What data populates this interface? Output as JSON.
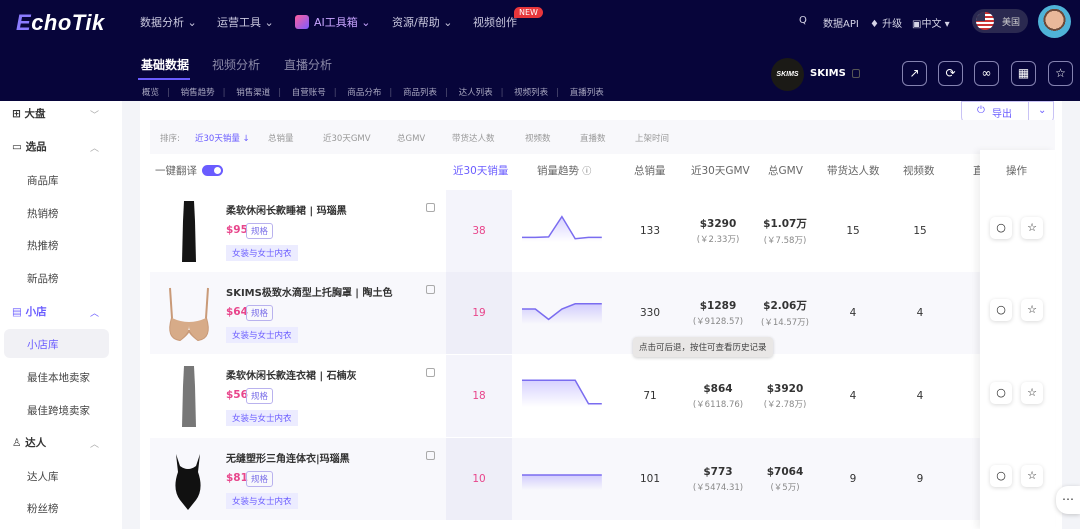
{
  "header": {
    "logo": "EchoTik",
    "nav": [
      "数据分析",
      "运营工具",
      "AI工具箱",
      "资源/帮助",
      "视频创作"
    ],
    "new_badge": "NEW",
    "search": "Q",
    "api": "数据API",
    "upgrade": "升级",
    "language": "中文",
    "country": "美国"
  },
  "tabs": [
    "基础数据",
    "视频分析",
    "直播分析"
  ],
  "subnav": [
    "概览",
    "销售趋势",
    "销售渠道",
    "自营账号",
    "商品分布",
    "商品列表",
    "达人列表",
    "视频列表",
    "直播列表"
  ],
  "shop": {
    "logo_text": "SKIMS",
    "name": "SKIMS"
  },
  "sidebar": {
    "groups": [
      {
        "label": "大盘"
      },
      {
        "label": "选品",
        "items": [
          "商品库",
          "热销榜",
          "热推榜",
          "新品榜"
        ]
      },
      {
        "label": "小店",
        "items": [
          "小店库",
          "最佳本地卖家",
          "最佳跨境卖家"
        ]
      },
      {
        "label": "达人",
        "items": [
          "达人库",
          "粉丝榜"
        ]
      }
    ]
  },
  "sort": {
    "label": "排序:",
    "options": [
      "近30天销量 ↓",
      "总销量",
      "近30天GMV",
      "总GMV",
      "带货达人数",
      "视频数",
      "直播数",
      "上架时间"
    ]
  },
  "export": "导出",
  "translate": "一键翻译",
  "columns": [
    "近30天销量",
    "销量趋势",
    "总销量",
    "近30天GMV",
    "总GMV",
    "带货达人数",
    "视频数",
    "直",
    "操作"
  ],
  "spec_label": "规格",
  "tooltip": "点击可后退，按住可查看历史记录",
  "colors": {
    "accent": "#6a5cff",
    "pink": "#e8458b",
    "header": "#07053a"
  },
  "rows": [
    {
      "title": "柔软休闲长款睡裙 | 玛瑙黑",
      "price": "$95",
      "category": "女装与女士内衣",
      "sales30": "38",
      "total": "133",
      "gmv30": "$3290",
      "gmv30_cny": "(￥2.33万)",
      "gmv": "$1.07万",
      "gmv_cny": "(￥7.58万)",
      "creators": "15",
      "videos": "15",
      "trend": [
        0.1,
        0.1,
        0.12,
        0.9,
        0.05,
        0.1,
        0.1
      ]
    },
    {
      "title": "SKIMS极致水滴型上托胸罩 | 陶土色",
      "price": "$64",
      "category": "女装与女士内衣",
      "sales30": "19",
      "total": "330",
      "gmv30": "$1289",
      "gmv30_cny": "(￥9128.57)",
      "gmv": "$2.06万",
      "gmv_cny": "(￥14.57万)",
      "creators": "4",
      "videos": "4",
      "trend": [
        0.5,
        0.5,
        0.1,
        0.5,
        0.7,
        0.7,
        0.7
      ]
    },
    {
      "title": "柔软休闲长款连衣裙 | 石楠灰",
      "price": "$56",
      "category": "女装与女士内衣",
      "sales30": "18",
      "total": "71",
      "gmv30": "$864",
      "gmv30_cny": "(￥6118.76)",
      "gmv": "$3920",
      "gmv_cny": "(￥2.78万)",
      "creators": "4",
      "videos": "4",
      "trend": [
        0.95,
        0.95,
        0.95,
        0.95,
        0.95,
        0.05,
        0.05
      ]
    },
    {
      "title": "无缝塑形三角连体衣|玛瑙黑",
      "price": "$81",
      "category": "女装与女士内衣",
      "sales30": "10",
      "total": "101",
      "gmv30": "$773",
      "gmv30_cny": "(￥5474.31)",
      "gmv": "$7064",
      "gmv_cny": "(￥5万)",
      "creators": "9",
      "videos": "9",
      "trend": [
        0.5,
        0.5,
        0.5,
        0.5,
        0.5,
        0.5,
        0.5
      ]
    }
  ]
}
